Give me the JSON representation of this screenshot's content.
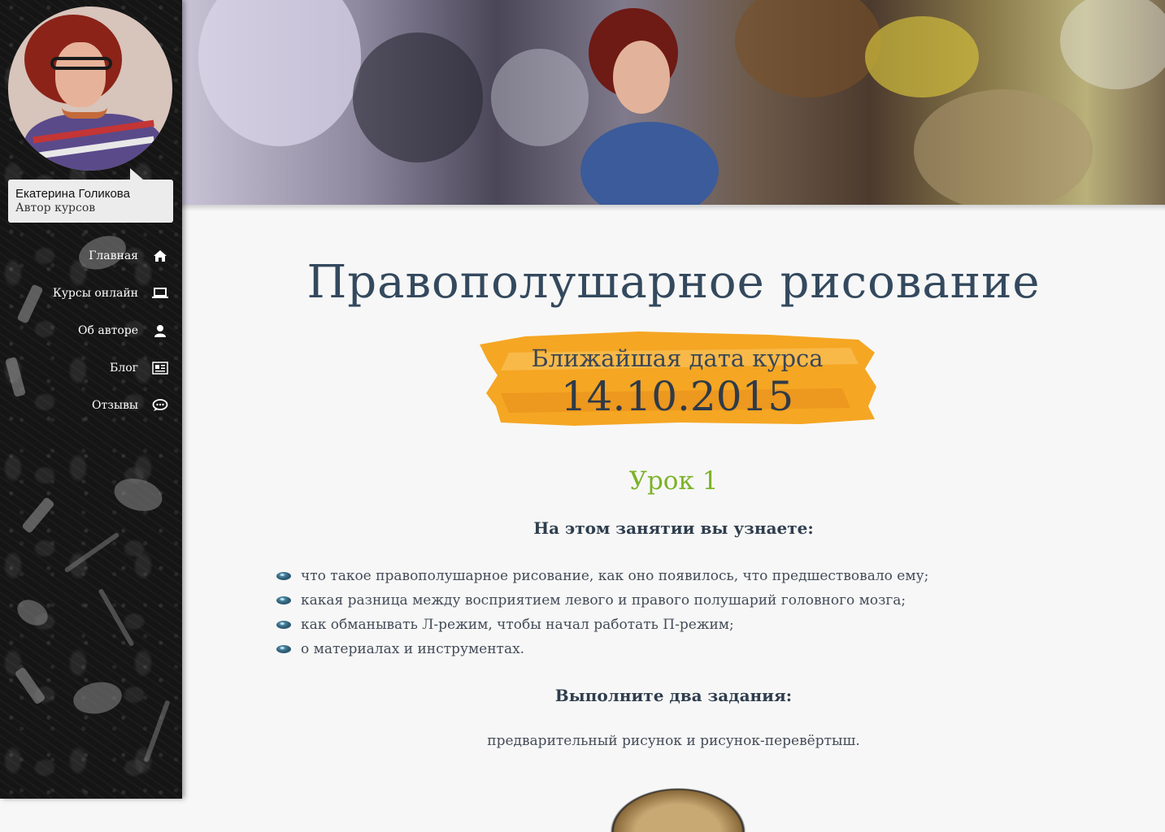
{
  "author": {
    "name": "Екатерина Голикова",
    "role": "Автор курсов"
  },
  "nav": {
    "items": [
      {
        "label": "Главная",
        "icon": "home-icon"
      },
      {
        "label": "Курсы онлайн",
        "icon": "laptop-icon"
      },
      {
        "label": "Об авторе",
        "icon": "user-icon"
      },
      {
        "label": "Блог",
        "icon": "newspaper-icon"
      },
      {
        "label": "Отзывы",
        "icon": "comments-icon"
      }
    ]
  },
  "main": {
    "title": "Правополушарное рисование",
    "date_label": "Ближайшая дата курса",
    "date_value": "14.10.2015",
    "lesson_title": "Урок 1",
    "learn_heading": "На этом занятии вы узнаете:",
    "bullets": [
      "что такое правополушарное рисование, как оно появилось,  что предшествовало ему;",
      "какая разница между восприятием левого и правого полушарий головного мозга;",
      "как обманывать Л-режим, чтобы начал работать П-режим;",
      "о материалах и инструментах."
    ],
    "tasks_heading": "Выполните два задания:",
    "tasks_text": "предварительный рисунок и рисунок-перевёртыш."
  },
  "colors": {
    "title": "#34495e",
    "lesson_accent": "#7cb228",
    "brush_banner": "#f5a623",
    "sidebar_bg": "#151515",
    "content_bg": "#f7f7f7"
  }
}
